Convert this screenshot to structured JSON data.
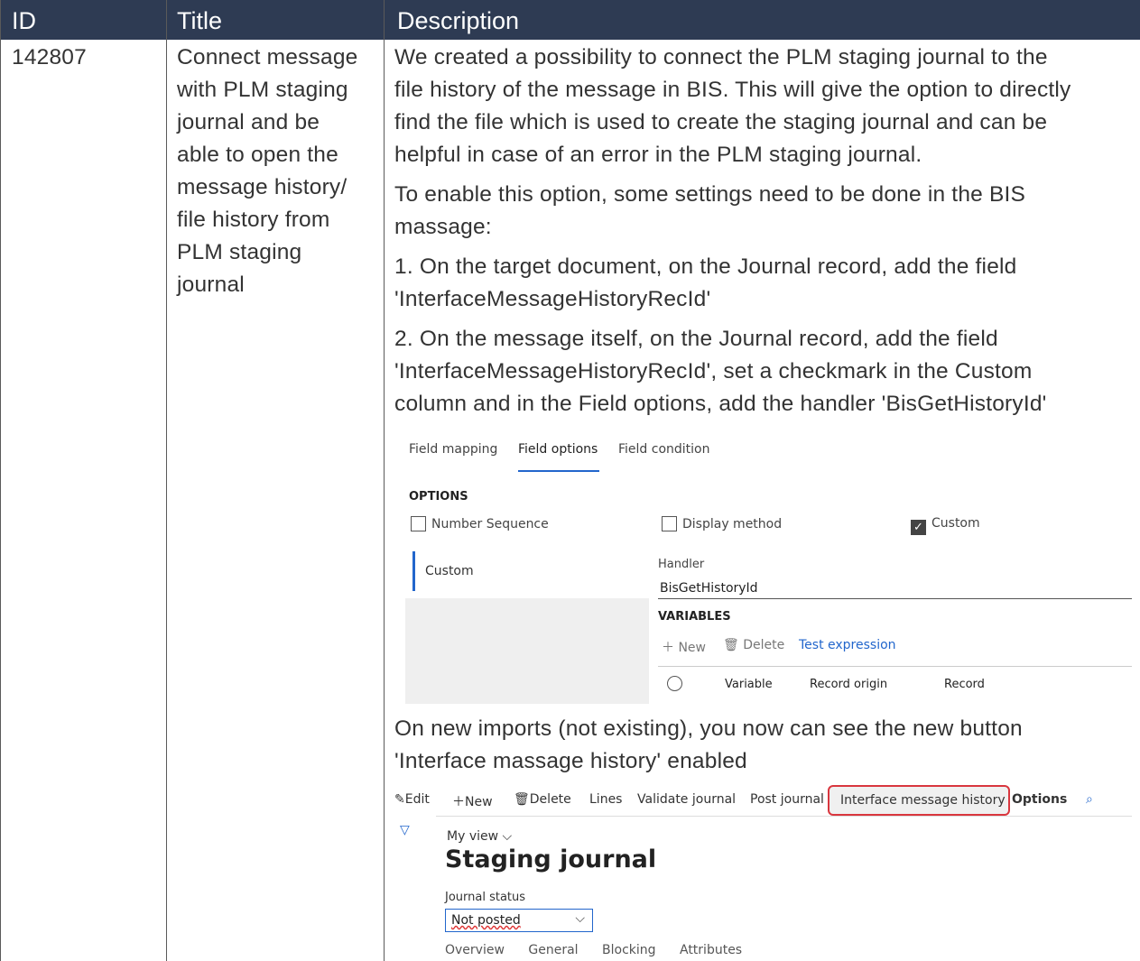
{
  "header": {
    "id": "ID",
    "title": "Title",
    "description": "Description"
  },
  "row": {
    "id": "142807",
    "title_lines": [
      "Connect message",
      "with PLM staging",
      "journal and be",
      "able to open the",
      "message history/",
      "file history from",
      "PLM staging",
      "journal"
    ],
    "paragraphs": [
      [
        "We created a possibility to connect the PLM staging journal to the",
        "file history of the message in BIS. This will give the option to directly",
        "find the file which is used to create the staging journal and can be",
        "helpful in case of an error in the PLM staging journal."
      ],
      [
        "To enable this option, some settings need to be done in the BIS",
        "massage:"
      ],
      [
        "1. On the target document, on the Journal record, add the field",
        "'InterfaceMessageHistoryRecId'"
      ],
      [
        "2. On the message itself, on the Journal record, add the field",
        "'InterfaceMessageHistoryRecId', set a checkmark in the Custom",
        "column and in the Field options, add the handler 'BisGetHistoryId'"
      ]
    ],
    "after_shot1": [
      "On new imports (not existing), you now can see the new button",
      "'Interface massage history' enabled"
    ]
  },
  "field_options_shot": {
    "tabs": [
      "Field mapping",
      "Field options",
      "Field condition"
    ],
    "options_label": "OPTIONS",
    "checkboxes": [
      {
        "label": "Number Sequence",
        "checked": false
      },
      {
        "label": "Display method",
        "checked": false
      },
      {
        "label": "Custom",
        "checked": true
      }
    ],
    "left_item": "Custom",
    "handler_label": "Handler",
    "handler_value": "BisGetHistoryId",
    "variables_label": "VARIABLES",
    "toolbar": {
      "new": "New",
      "delete": "Delete",
      "test": "Test expression"
    },
    "grid_columns": [
      "Variable",
      "Record origin",
      "Record"
    ]
  },
  "staging_shot": {
    "toolbar": {
      "edit": "Edit",
      "new": "New",
      "delete": "Delete",
      "lines": "Lines",
      "validate": "Validate journal",
      "post": "Post journal",
      "history": "Interface message history",
      "options": "Options"
    },
    "my_view": "My view",
    "title": "Staging journal",
    "status_label": "Journal status",
    "status_value": "Not posted",
    "subtabs": [
      "Overview",
      "General",
      "Blocking",
      "Attributes"
    ]
  }
}
